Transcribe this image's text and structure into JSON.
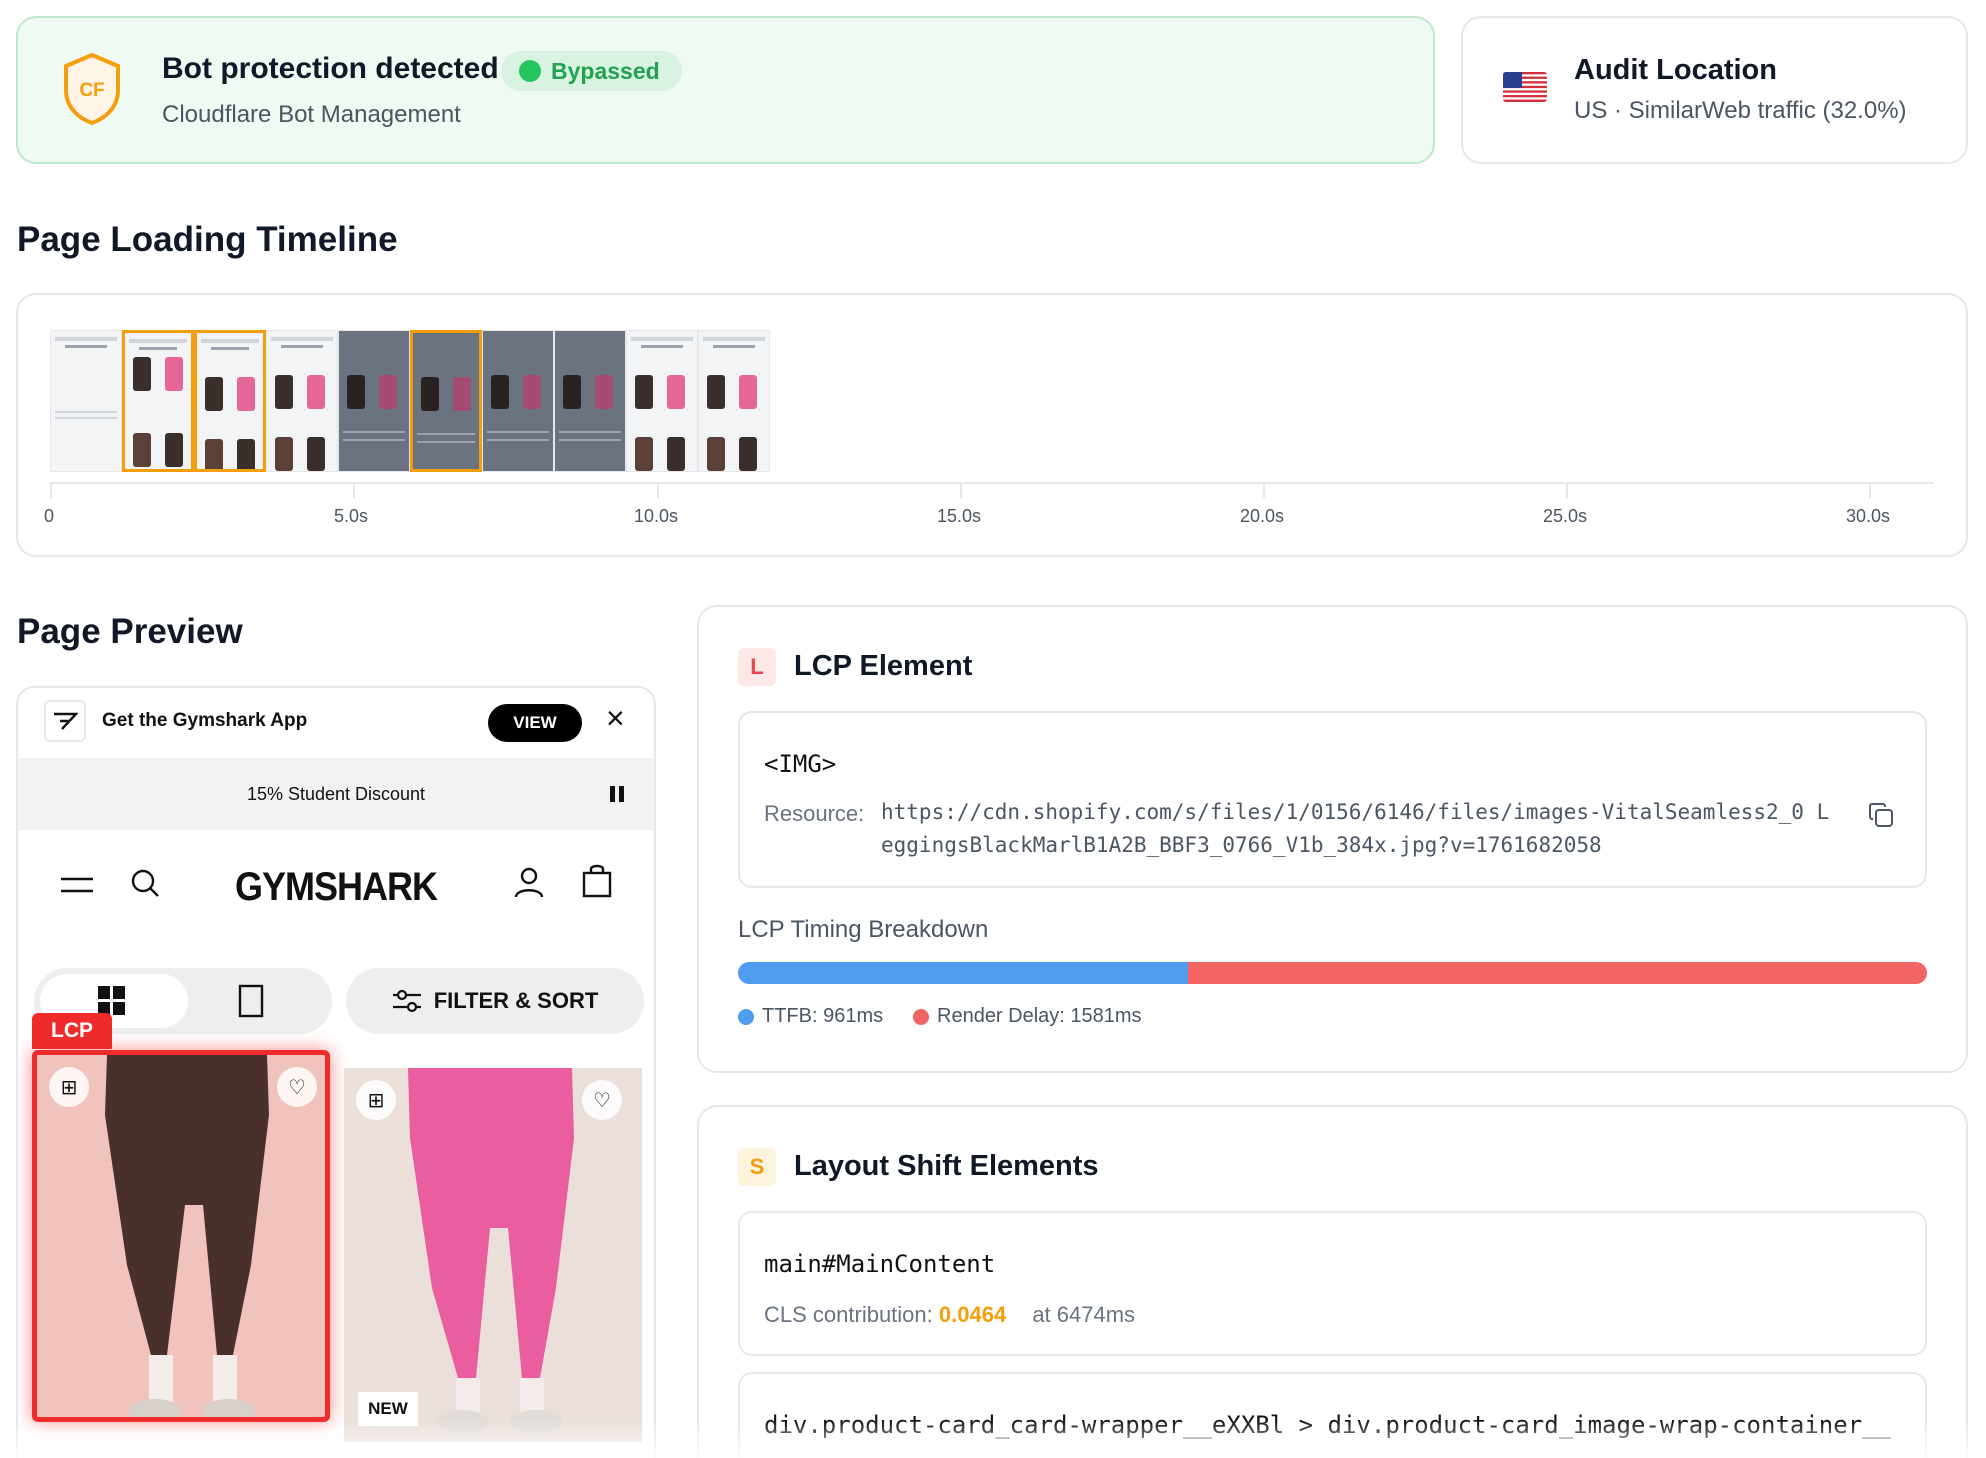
{
  "bot": {
    "title": "Bot protection detected",
    "status": "Bypassed",
    "provider": "Cloudflare Bot Management",
    "shield_text": "CF",
    "colors": {
      "accent": "#f59e0b",
      "status": "#22c55e"
    }
  },
  "audit": {
    "title": "Audit Location",
    "subtitle": "US · SimilarWeb traffic (32.0%)",
    "flag_icon": "us-flag-icon"
  },
  "timeline": {
    "title": "Page Loading Timeline",
    "ticks": [
      "0",
      "5.0s",
      "10.0s",
      "15.0s",
      "20.0s",
      "25.0s",
      "30.0s"
    ]
  },
  "preview": {
    "title": "Page Preview",
    "app_banner_text": "Get the Gymshark App",
    "view_label": "VIEW",
    "promo_text": "15% Student Discount ",
    "brand": "GYMSHARK",
    "filter_label": "FILTER & SORT",
    "lcp_tag": "LCP",
    "new_badge": "NEW"
  },
  "lcp": {
    "badge": "L",
    "title": "LCP Element",
    "tag": "<IMG>",
    "resource_label": "Resource:",
    "resource_url": "https://cdn.shopify.com/s/files/1/0156/6146/files/images-VitalSeamless2_0 LeggingsBlackMarlB1A2B_BBF3_0766_V1b_384x.jpg?v=1761682058",
    "timing_title": "LCP Timing Breakdown",
    "ttfb_ms": 961,
    "render_delay_ms": 1581,
    "ttfb_label": "TTFB: 961ms",
    "render_label": "Render Delay: 1581ms",
    "colors": {
      "ttfb": "#4f9cf0",
      "render": "#f26464"
    }
  },
  "layout_shift": {
    "badge": "S",
    "title": "Layout Shift Elements",
    "items": [
      {
        "selector": "main#MainContent",
        "cls_label": "CLS contribution:",
        "cls_value": "0.0464",
        "at": "at 6474ms"
      },
      {
        "selector": "div.product-card_card-wrapper__eXXBl > div.product-card_image-wrap-container__"
      }
    ]
  }
}
